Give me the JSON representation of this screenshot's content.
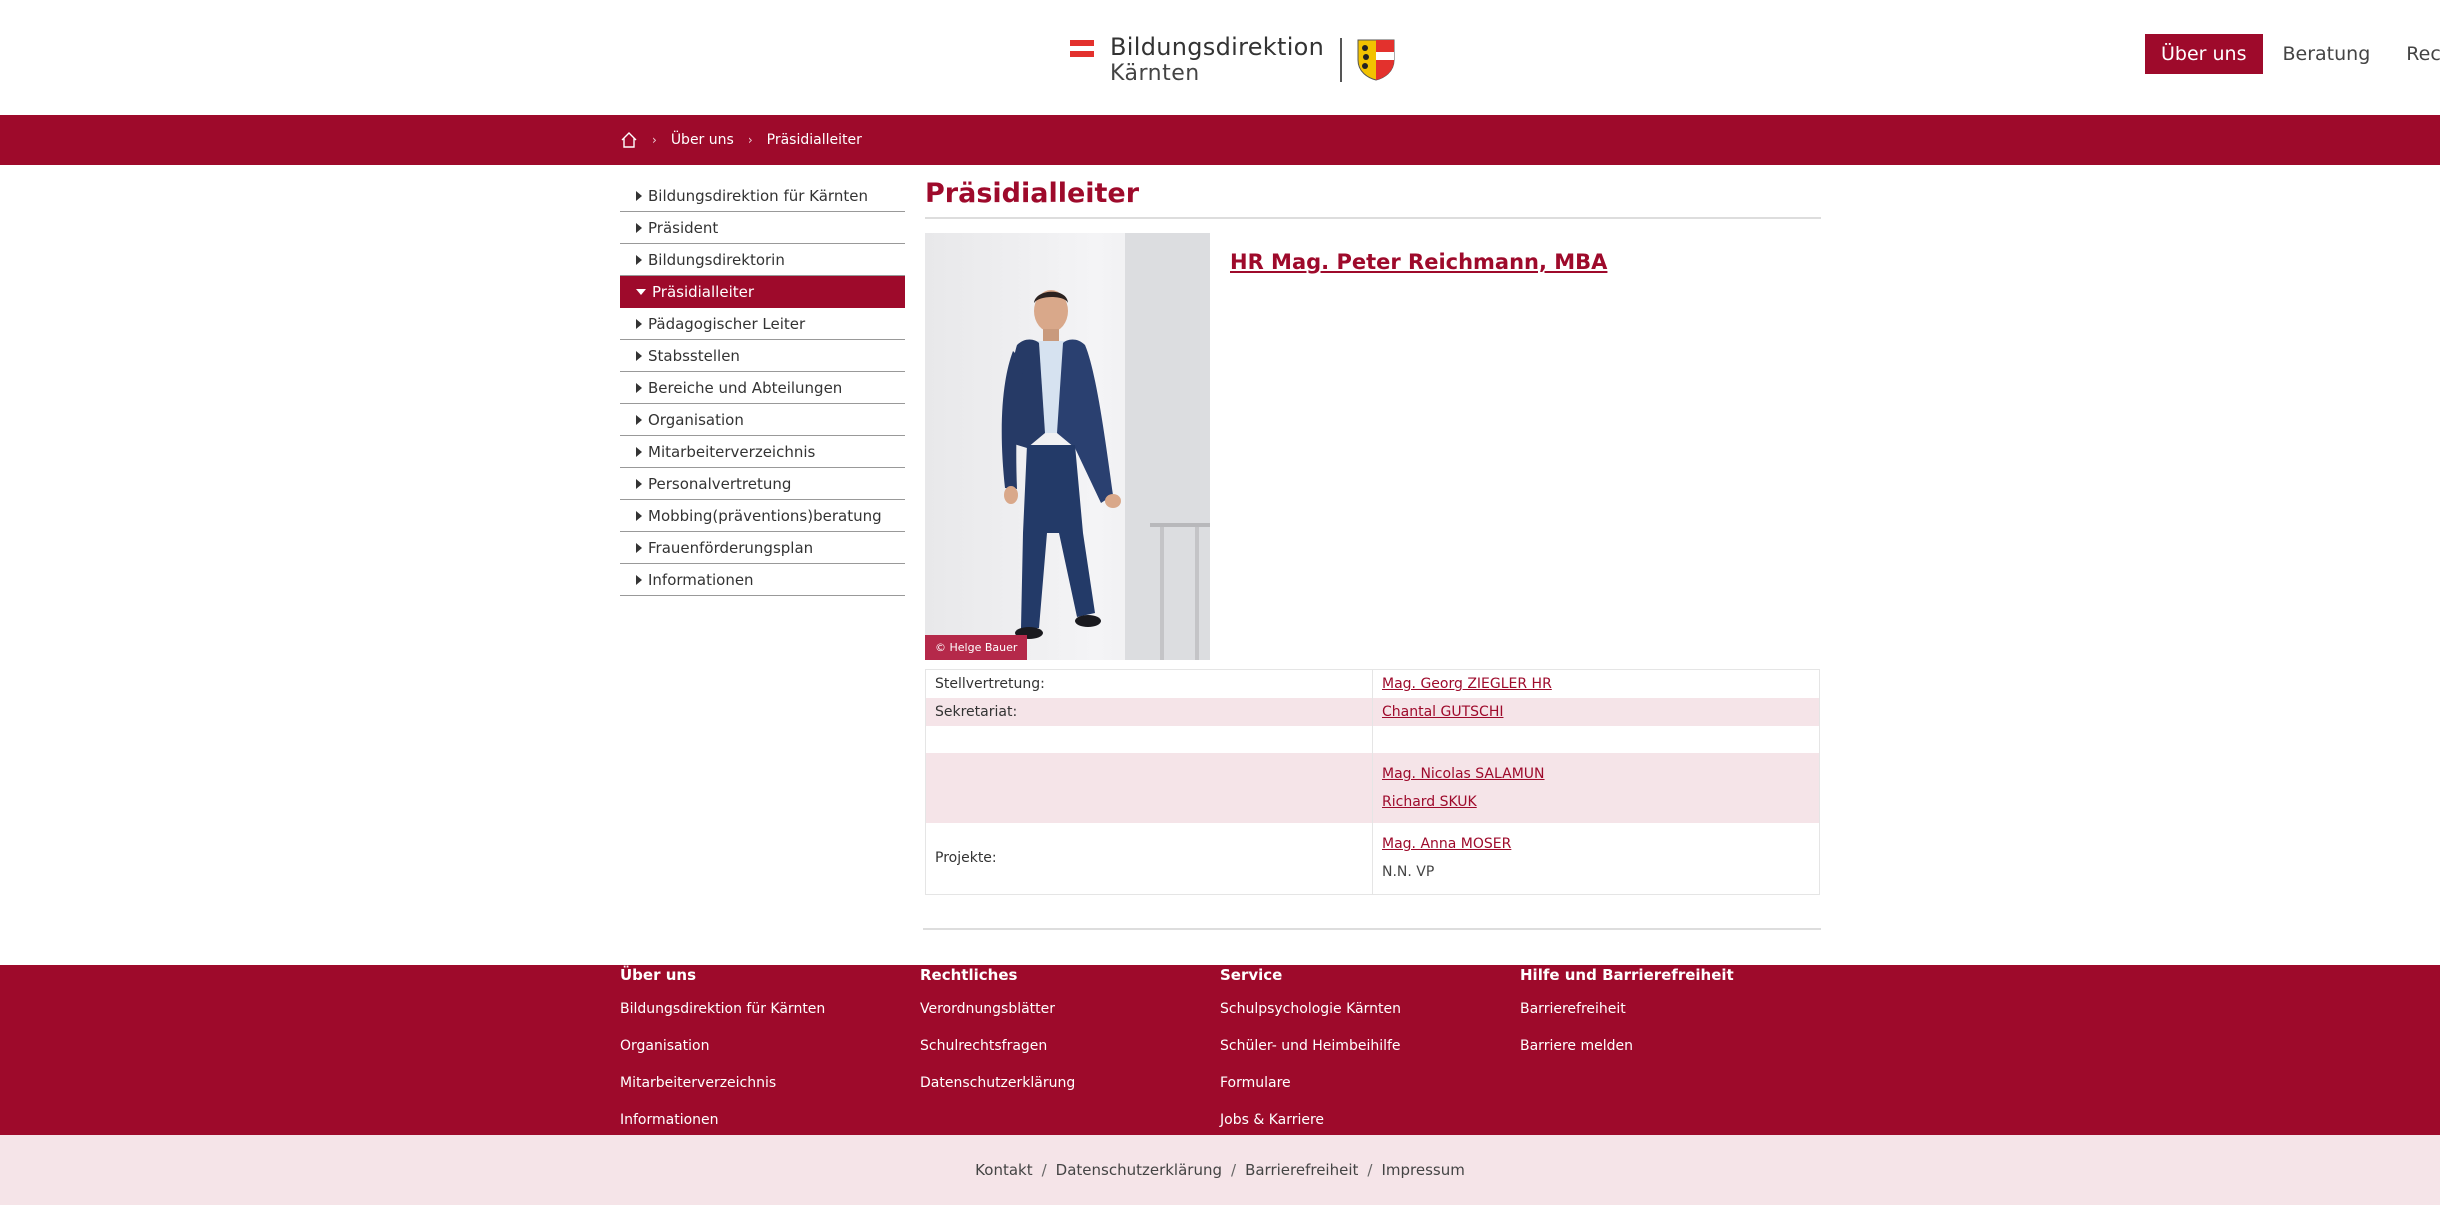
{
  "header": {
    "logo_line1": "Bildungsdirektion",
    "logo_line2": "Kärnten",
    "nav": [
      {
        "label": "Über uns",
        "active": true
      },
      {
        "label": "Beratung",
        "active": false
      },
      {
        "label": "Rechtliche",
        "active": false
      }
    ]
  },
  "breadcrumb": {
    "items": [
      "Über uns",
      "Präsidialleiter"
    ]
  },
  "sidebar": {
    "items": [
      {
        "label": "Bildungsdirektion für Kärnten"
      },
      {
        "label": "Präsident"
      },
      {
        "label": "Bildungsdirektorin"
      },
      {
        "label": "Präsidialleiter",
        "active": true
      },
      {
        "label": "Pädagogischer Leiter"
      },
      {
        "label": "Stabsstellen"
      },
      {
        "label": "Bereiche und Abteilungen"
      },
      {
        "label": "Organisation"
      },
      {
        "label": "Mitarbeiterverzeichnis"
      },
      {
        "label": "Personalvertretung"
      },
      {
        "label": "Mobbing(präventions)beratung"
      },
      {
        "label": "Frauenförderungsplan"
      },
      {
        "label": "Informationen"
      }
    ]
  },
  "main": {
    "title": "Präsidialleiter",
    "photo_credit": "© Helge Bauer",
    "person_name": "HR Mag. Peter Reichmann, MBA",
    "rows": [
      {
        "label": "Stellvertretung:",
        "links": [
          "Mag. Georg ZIEGLER HR"
        ]
      },
      {
        "label": "Sekretariat:",
        "links": [
          "Chantal GUTSCHI"
        ]
      },
      {
        "label": "",
        "links": []
      },
      {
        "label": "",
        "links": [
          "Mag. Nicolas SALAMUN",
          "Richard SKUK"
        ]
      },
      {
        "label": "Projekte:",
        "links": [
          "Mag. Anna MOSER"
        ],
        "text": "N.N. VP"
      }
    ]
  },
  "footer": {
    "columns": [
      {
        "title": "Über uns",
        "links": [
          "Bildungsdirektion für Kärnten",
          "Organisation",
          "Mitarbeiterverzeichnis",
          "Informationen"
        ]
      },
      {
        "title": "Rechtliches",
        "links": [
          "Verordnungsblätter",
          "Schulrechtsfragen",
          "Datenschutzerklärung"
        ]
      },
      {
        "title": "Service",
        "links": [
          "Schulpsychologie Kärnten",
          "Schüler- und Heimbeihilfe",
          "Formulare",
          "Jobs & Karriere"
        ]
      },
      {
        "title": "Hilfe und Barrierefreiheit",
        "links": [
          "Barrierefreiheit",
          "Barriere melden"
        ]
      }
    ],
    "bottom_links": [
      "Kontakt",
      "Datenschutzerklärung",
      "Barrierefreiheit",
      "Impressum"
    ]
  },
  "colors": {
    "brand": "#9e0a2b",
    "row_alt": "#f5e4e8",
    "subfooter_bg": "#f5e4e8"
  }
}
